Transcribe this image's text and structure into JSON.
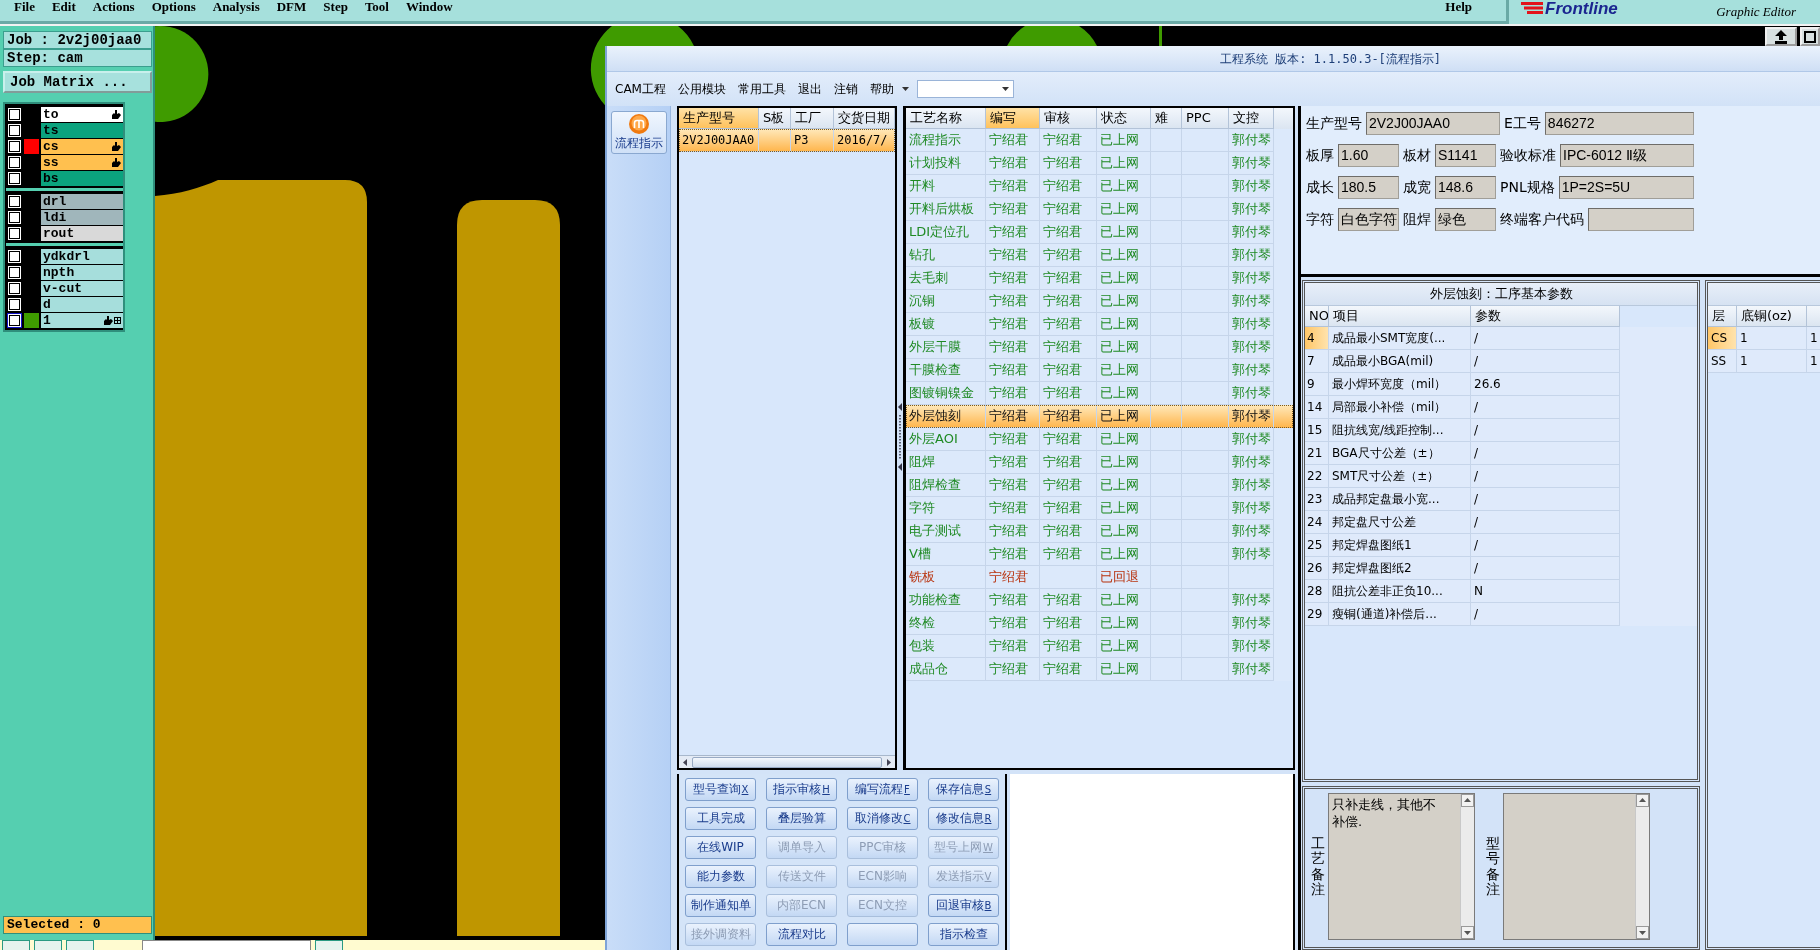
{
  "menu_bar": {
    "items": [
      "File",
      "Edit",
      "Actions",
      "Options",
      "Analysis",
      "DFM",
      "Step",
      "Tool",
      "Window"
    ],
    "help": "Help",
    "logo": "Frontline",
    "logo_caption": "Graphic Editor"
  },
  "job_panel": {
    "job": "Job : 2v2j00jaa0",
    "step": "Step: cam",
    "matrix_button": "Job Matrix ...",
    "selected_count": "Selected : 0",
    "layer_groups": [
      {
        "layers": [
          {
            "name": "to",
            "color": "#ffffff",
            "checked": false,
            "hand_mark": true,
            "grid_mark": false,
            "focused": false
          },
          {
            "name": "ts",
            "color": "#0ba37e",
            "checked": false,
            "hand_mark": false,
            "grid_mark": false,
            "focused": false
          },
          {
            "name": "cs",
            "color": "#ffc04f",
            "swatch": {
              "color": "#ff0000"
            },
            "checked": false,
            "hand_mark": true,
            "grid_mark": false,
            "focused": false
          },
          {
            "name": "ss",
            "color": "#ffc04f",
            "checked": false,
            "hand_mark": true,
            "grid_mark": false,
            "focused": false
          },
          {
            "name": "bs",
            "color": "#0ba37e",
            "checked": false,
            "hand_mark": false,
            "grid_mark": false,
            "focused": false
          }
        ]
      },
      {
        "layers": [
          {
            "name": "drl",
            "color": "#a0b6bb",
            "checked": false,
            "hand_mark": false,
            "grid_mark": false,
            "focused": false
          },
          {
            "name": "ldi",
            "color": "#a0b6bb",
            "checked": false,
            "hand_mark": false,
            "grid_mark": false,
            "focused": false
          },
          {
            "name": "rout",
            "color": "#d9d9d9",
            "checked": false,
            "hand_mark": false,
            "grid_mark": false,
            "focused": false
          }
        ]
      },
      {
        "layers": [
          {
            "name": "ydkdrl",
            "color": "#a6dedc",
            "checked": false,
            "hand_mark": false,
            "grid_mark": false,
            "focused": false
          },
          {
            "name": "npth",
            "color": "#a6dedc",
            "checked": false,
            "hand_mark": false,
            "grid_mark": false,
            "focused": false
          },
          {
            "name": "v-cut",
            "color": "#a6dedc",
            "checked": false,
            "hand_mark": false,
            "grid_mark": false,
            "focused": false
          },
          {
            "name": "d",
            "color": "#a6dedc",
            "checked": false,
            "hand_mark": false,
            "grid_mark": false,
            "focused": false
          },
          {
            "name": "1",
            "color": "#a6dedc",
            "swatch": {
              "color": "#3f9b00"
            },
            "checked": false,
            "hand_mark": true,
            "grid_mark": true,
            "focused": true
          }
        ]
      }
    ]
  },
  "dialog": {
    "title": "工程系统 版本: 1.1.50.3-[流程指示]",
    "menu": [
      "CAM工程",
      "公用模块",
      "常用工具",
      "退出",
      "注销",
      "帮助"
    ],
    "sidebar_button": "流程指示"
  },
  "products": {
    "columns": [
      {
        "label": "生产型号",
        "sorted": true
      },
      {
        "label": "S板",
        "sorted": false
      },
      {
        "label": "工厂",
        "sorted": false
      },
      {
        "label": "交货日期",
        "sorted": false
      }
    ],
    "rows": [
      {
        "model": "2V2J00JAA0",
        "factory": "P3",
        "delivery_date": "2016/7/",
        "selected": true
      }
    ]
  },
  "process": {
    "columns": [
      {
        "label": "工艺名称",
        "sorted": false
      },
      {
        "label": "编写",
        "sorted": true
      },
      {
        "label": "审核",
        "sorted": false
      },
      {
        "label": "状态",
        "sorted": false
      },
      {
        "label": "难",
        "sorted": false
      },
      {
        "label": "PPC",
        "sorted": false
      },
      {
        "label": "文控",
        "sorted": false
      }
    ],
    "rows": [
      {
        "step": "流程指示",
        "author": "宁绍君",
        "reviewer": "宁绍君",
        "status": "已上网",
        "doc_control": "郭付琴",
        "selected": false,
        "returned": false
      },
      {
        "step": "计划投料",
        "author": "宁绍君",
        "reviewer": "宁绍君",
        "status": "已上网",
        "doc_control": "郭付琴",
        "selected": false,
        "returned": false
      },
      {
        "step": "开料",
        "author": "宁绍君",
        "reviewer": "宁绍君",
        "status": "已上网",
        "doc_control": "郭付琴",
        "selected": false,
        "returned": false
      },
      {
        "step": "开料后烘板",
        "author": "宁绍君",
        "reviewer": "宁绍君",
        "status": "已上网",
        "doc_control": "郭付琴",
        "selected": false,
        "returned": false
      },
      {
        "step": "LDI定位孔",
        "author": "宁绍君",
        "reviewer": "宁绍君",
        "status": "已上网",
        "doc_control": "郭付琴",
        "selected": false,
        "returned": false
      },
      {
        "step": "钻孔",
        "author": "宁绍君",
        "reviewer": "宁绍君",
        "status": "已上网",
        "doc_control": "郭付琴",
        "selected": false,
        "returned": false
      },
      {
        "step": "去毛刺",
        "author": "宁绍君",
        "reviewer": "宁绍君",
        "status": "已上网",
        "doc_control": "郭付琴",
        "selected": false,
        "returned": false
      },
      {
        "step": "沉铜",
        "author": "宁绍君",
        "reviewer": "宁绍君",
        "status": "已上网",
        "doc_control": "郭付琴",
        "selected": false,
        "returned": false
      },
      {
        "step": "板镀",
        "author": "宁绍君",
        "reviewer": "宁绍君",
        "status": "已上网",
        "doc_control": "郭付琴",
        "selected": false,
        "returned": false
      },
      {
        "step": "外层干膜",
        "author": "宁绍君",
        "reviewer": "宁绍君",
        "status": "已上网",
        "doc_control": "郭付琴",
        "selected": false,
        "returned": false
      },
      {
        "step": "干膜检查",
        "author": "宁绍君",
        "reviewer": "宁绍君",
        "status": "已上网",
        "doc_control": "郭付琴",
        "selected": false,
        "returned": false
      },
      {
        "step": "图镀铜镍金",
        "author": "宁绍君",
        "reviewer": "宁绍君",
        "status": "已上网",
        "doc_control": "郭付琴",
        "selected": false,
        "returned": false
      },
      {
        "step": "外层蚀刻",
        "author": "宁绍君",
        "reviewer": "宁绍君",
        "status": "已上网",
        "doc_control": "郭付琴",
        "selected": true,
        "returned": false
      },
      {
        "step": "外层AOI",
        "author": "宁绍君",
        "reviewer": "宁绍君",
        "status": "已上网",
        "doc_control": "郭付琴",
        "selected": false,
        "returned": false
      },
      {
        "step": "阻焊",
        "author": "宁绍君",
        "reviewer": "宁绍君",
        "status": "已上网",
        "doc_control": "郭付琴",
        "selected": false,
        "returned": false
      },
      {
        "step": "阻焊检查",
        "author": "宁绍君",
        "reviewer": "宁绍君",
        "status": "已上网",
        "doc_control": "郭付琴",
        "selected": false,
        "returned": false
      },
      {
        "step": "字符",
        "author": "宁绍君",
        "reviewer": "宁绍君",
        "status": "已上网",
        "doc_control": "郭付琴",
        "selected": false,
        "returned": false
      },
      {
        "step": "电子测试",
        "author": "宁绍君",
        "reviewer": "宁绍君",
        "status": "已上网",
        "doc_control": "郭付琴",
        "selected": false,
        "returned": false
      },
      {
        "step": "V槽",
        "author": "宁绍君",
        "reviewer": "宁绍君",
        "status": "已上网",
        "doc_control": "郭付琴",
        "selected": false,
        "returned": false
      },
      {
        "step": "铣板",
        "author": "宁绍君",
        "status": "已回退",
        "selected": false,
        "returned": true
      },
      {
        "step": "功能检查",
        "author": "宁绍君",
        "reviewer": "宁绍君",
        "status": "已上网",
        "doc_control": "郭付琴",
        "selected": false,
        "returned": false
      },
      {
        "step": "终检",
        "author": "宁绍君",
        "reviewer": "宁绍君",
        "status": "已上网",
        "doc_control": "郭付琴",
        "selected": false,
        "returned": false
      },
      {
        "step": "包装",
        "author": "宁绍君",
        "reviewer": "宁绍君",
        "status": "已上网",
        "doc_control": "郭付琴",
        "selected": false,
        "returned": false
      },
      {
        "step": "成品仓",
        "author": "宁绍君",
        "reviewer": "宁绍君",
        "status": "已上网",
        "doc_control": "郭付琴",
        "selected": false,
        "returned": false
      }
    ]
  },
  "info": {
    "fields": [
      {
        "label": "生产型号",
        "value": "2V2J00JAA0"
      },
      {
        "label": "E工号",
        "value": "846272"
      },
      {
        "label": "板厚",
        "value": "1.60"
      },
      {
        "label": "板材",
        "value": "S1141"
      },
      {
        "label": "验收标准",
        "value": "IPC-6012 Ⅱ级"
      },
      {
        "label": "成长",
        "value": "180.5"
      },
      {
        "label": "成宽",
        "value": "148.6"
      },
      {
        "label": "PNL规格",
        "value": "1P=2S=5U"
      },
      {
        "label": "字符",
        "value": "白色字符"
      },
      {
        "label": "阻焊",
        "value": "绿色"
      },
      {
        "label": "终端客户代码"
      }
    ]
  },
  "params": {
    "title": "外层蚀刻：工序基本参数",
    "columns": [
      "NO",
      "项目",
      "参数"
    ],
    "rows": [
      {
        "no": "4",
        "item": "成品最小SMT宽度(...",
        "value": "/",
        "selected": true
      },
      {
        "no": "7",
        "item": "成品最小BGA(mil)",
        "value": "/",
        "selected": false
      },
      {
        "no": "9",
        "item": "最小焊环宽度（mil）",
        "value": "26.6",
        "selected": false
      },
      {
        "no": "14",
        "item": "局部最小补偿（mil）",
        "value": "/",
        "selected": false
      },
      {
        "no": "15",
        "item": "阻抗线宽/线距控制...",
        "value": "/",
        "selected": false
      },
      {
        "no": "21",
        "item": "BGA尺寸公差（±）",
        "value": "/",
        "selected": false
      },
      {
        "no": "22",
        "item": "SMT尺寸公差（±）",
        "value": "/",
        "selected": false
      },
      {
        "no": "23",
        "item": "成品邦定盘最小宽...",
        "value": "/",
        "selected": false
      },
      {
        "no": "24",
        "item": "邦定盘尺寸公差",
        "value": "/",
        "selected": false
      },
      {
        "no": "25",
        "item": "邦定焊盘图纸1",
        "value": "/",
        "selected": false
      },
      {
        "no": "26",
        "item": "邦定焊盘图纸2",
        "value": "/",
        "selected": false
      },
      {
        "no": "28",
        "item": "阻抗公差非正负10...",
        "value": "N",
        "selected": false
      },
      {
        "no": "29",
        "item": "瘦铜(通道)补偿后...",
        "value": "/",
        "selected": false
      }
    ]
  },
  "layer_copper": {
    "columns": [
      "层",
      "底铜(oz)"
    ],
    "rows": [
      {
        "layer": "CS",
        "base_copper": "1",
        "column_3": "1",
        "selected": true
      },
      {
        "layer": "SS",
        "base_copper": "1",
        "column_3": "1",
        "selected": false
      }
    ]
  },
  "buttons": [
    {
      "label": "型号查询",
      "key": "X",
      "disabled": false
    },
    {
      "label": "指示审核",
      "key": "H",
      "disabled": false
    },
    {
      "label": "编写流程",
      "key": "F",
      "disabled": false
    },
    {
      "label": "保存信息",
      "key": "S",
      "disabled": false
    },
    {
      "label": "工具完成",
      "disabled": false
    },
    {
      "label": "叠层验算",
      "disabled": false
    },
    {
      "label": "取消修改",
      "key": "C",
      "disabled": false
    },
    {
      "label": "修改信息",
      "key": "R",
      "disabled": false
    },
    {
      "label": "在线WIP",
      "disabled": false
    },
    {
      "label": "调单导入",
      "disabled": true
    },
    {
      "label": "PPC审核",
      "disabled": true
    },
    {
      "label": "型号上网",
      "key": "W",
      "disabled": true
    },
    {
      "label": "能力参数",
      "disabled": false
    },
    {
      "label": "传送文件",
      "disabled": true
    },
    {
      "label": "ECN影响",
      "disabled": true
    },
    {
      "label": "发送指示",
      "key": "V",
      "disabled": true
    },
    {
      "label": "制作通知单",
      "disabled": false
    },
    {
      "label": "内部ECN",
      "disabled": true
    },
    {
      "label": "ECN文控",
      "disabled": true
    },
    {
      "label": "回退审核",
      "key": "B",
      "disabled": false
    },
    {
      "label": "接外调资料",
      "disabled": true
    },
    {
      "label": "流程对比",
      "disabled": false
    },
    {
      "disabled": false
    },
    {
      "label": "指示检查",
      "disabled": false
    }
  ],
  "notes": [
    {
      "label": "工艺备注",
      "text": "只补走线，其他不补偿."
    },
    {
      "label": "型号备注"
    }
  ]
}
